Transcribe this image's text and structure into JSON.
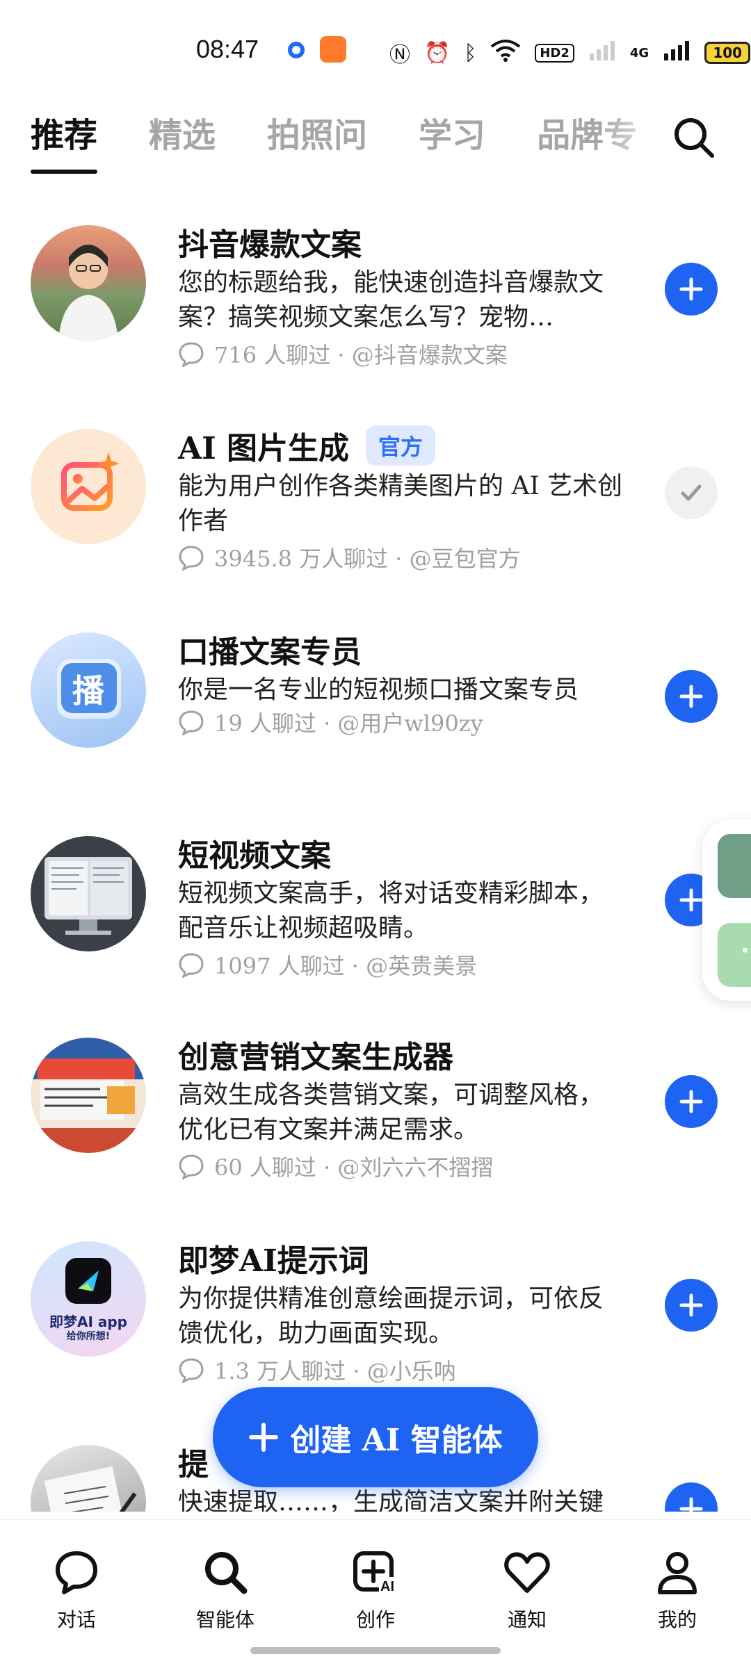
{
  "status_bar": {
    "time": "08:47",
    "network": "4G",
    "hd_badge": "HD2",
    "battery": "100",
    "icons": [
      "nfc-icon",
      "alarm-icon",
      "bluetooth-icon",
      "wifi-icon",
      "signal-icon"
    ]
  },
  "tabs": [
    {
      "label": "推荐",
      "active": true
    },
    {
      "label": "精选",
      "active": false
    },
    {
      "label": "拍照问",
      "active": false
    },
    {
      "label": "学习",
      "active": false
    },
    {
      "label": "品牌专",
      "active": false
    }
  ],
  "agents": [
    {
      "title": "抖音爆款文案",
      "official": false,
      "desc": "您的标题给我，能快速创造抖音爆款文案？搞笑视频文案怎么写？宠物…",
      "meta": "716 人聊过 · @抖音爆款文案",
      "action": "add"
    },
    {
      "title": "AI 图片生成",
      "official": true,
      "official_label": "官方",
      "desc": "能为用户创作各类精美图片的 AI 艺术创作者",
      "meta": "3945.8 万人聊过 · @豆包官方",
      "action": "added"
    },
    {
      "title": "口播文案专员",
      "official": false,
      "desc": "你是一名专业的短视频口播文案专员",
      "meta": "19 人聊过 · @用户wl90zy",
      "action": "add"
    },
    {
      "title": "短视频文案",
      "official": false,
      "desc": "短视频文案高手，将对话变精彩脚本，配音乐让视频超吸睛。",
      "meta": "1097 人聊过 · @英贵美景",
      "action": "add"
    },
    {
      "title": "创意营销文案生成器",
      "official": false,
      "desc": "高效生成各类营销文案，可调整风格，优化已有文案并满足需求。",
      "meta": "60 人聊过 · @刘六六不摺摺",
      "action": "add"
    },
    {
      "title": "即梦AI提示词",
      "official": false,
      "desc": "为你提供精准创意绘画提示词，可依反馈优化，助力画面实现。",
      "meta": "1.3 万人聊过 · @小乐呐",
      "action": "add",
      "avatar_text": [
        "即梦AI app",
        "给你所想!"
      ]
    },
    {
      "title": "提",
      "official": false,
      "desc": "快速提取……，生成简洁文案并附关键词标签。",
      "meta": "",
      "action": "add"
    }
  ],
  "avatar_labels": {
    "broadcast": "播"
  },
  "create_button": {
    "label": "创建 AI 智能体"
  },
  "bottom_nav": [
    {
      "label": "对话",
      "icon": "chat-bubble-icon"
    },
    {
      "label": "智能体",
      "icon": "search-icon"
    },
    {
      "label": "创作",
      "icon": "create-ai-icon"
    },
    {
      "label": "通知",
      "icon": "heart-icon"
    },
    {
      "label": "我的",
      "icon": "profile-icon"
    }
  ],
  "colors": {
    "accent": "#1f63f2",
    "official_bg": "#dfe9ff",
    "muted_text": "#a0a0a0",
    "inactive_tab": "#a6a6a6"
  }
}
